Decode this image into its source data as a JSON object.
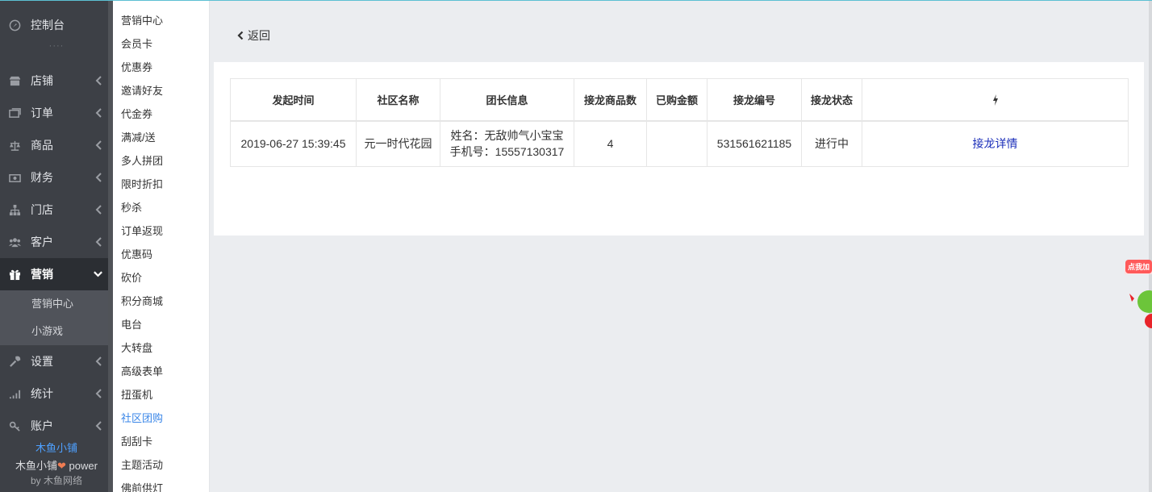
{
  "sidebar": {
    "items": [
      {
        "label": "控制台",
        "icon": "dashboard-icon"
      },
      {
        "label": "店铺",
        "icon": "shop-icon"
      },
      {
        "label": "订单",
        "icon": "order-icon"
      },
      {
        "label": "商品",
        "icon": "scale-icon"
      },
      {
        "label": "财务",
        "icon": "money-icon"
      },
      {
        "label": "门店",
        "icon": "sitemap-icon"
      },
      {
        "label": "客户",
        "icon": "users-icon"
      },
      {
        "label": "营销",
        "icon": "gift-icon"
      },
      {
        "label": "设置",
        "icon": "wrench-icon"
      },
      {
        "label": "统计",
        "icon": "signal-icon"
      },
      {
        "label": "账户",
        "icon": "key-icon"
      }
    ],
    "dots": "····",
    "sub_items": [
      "营销中心",
      "小游戏"
    ],
    "brand": "木鱼小铺",
    "power_prefix": "木鱼小铺",
    "power_suffix": " power",
    "by_prefix": "by ",
    "by_name": "木鱼网络"
  },
  "submenu": {
    "items": [
      "营销中心",
      "会员卡",
      "优惠券",
      "邀请好友",
      "代金券",
      "满减/送",
      "多人拼团",
      "限时折扣",
      "秒杀",
      "订单返现",
      "优惠码",
      "砍价",
      "积分商城",
      "电台",
      "大转盘",
      "高级表单",
      "扭蛋机",
      "社区团购",
      "刮刮卡",
      "主题活动",
      "佛前供灯"
    ],
    "active_index": 17
  },
  "back_label": "返回",
  "table": {
    "headers": [
      "发起时间",
      "社区名称",
      "团长信息",
      "接龙商品数",
      "已购金额",
      "接龙编号",
      "接龙状态"
    ],
    "rows": [
      {
        "time": "2019-06-27 15:39:45",
        "community": "元一时代花园",
        "leader_name": "姓名：无敌帅气小宝宝",
        "leader_phone": "手机号：15557130317",
        "goods_count": "4",
        "amount": "",
        "number": "531561621185",
        "status": "进行中",
        "action": "接龙详情"
      }
    ]
  },
  "float_widget": {
    "label": "点我加"
  },
  "colors": {
    "sidebar_bg": "#3d4046",
    "active_link": "#3a86e8",
    "brand": "#4ea0ff",
    "action_link": "#1a2db9"
  }
}
